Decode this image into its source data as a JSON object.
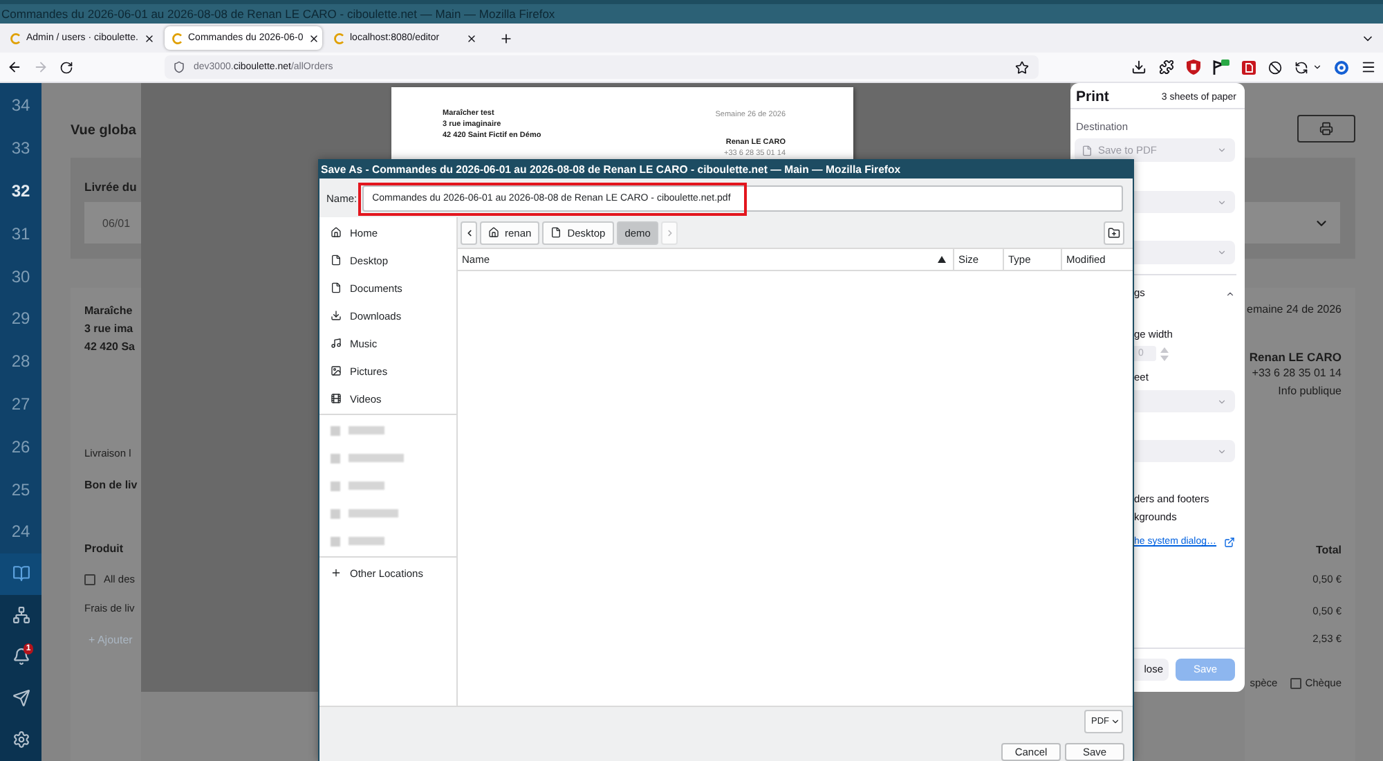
{
  "window": {
    "title": "Commandes du 2026-06-01 au 2026-08-08 de Renan LE CARO - ciboulette.net — Main — Mozilla Firefox"
  },
  "tabs": [
    {
      "label": "Admin / users · ciboulette.",
      "selected": false
    },
    {
      "label": "Commandes du 2026-06-0",
      "selected": true
    },
    {
      "label": "localhost:8080/editor",
      "selected": false
    }
  ],
  "navigation": {
    "back_disabled": false,
    "forward_disabled": true
  },
  "address_bar": {
    "host_prefix": "dev3000.",
    "domain": "ciboulette.net",
    "path": "/allOrders"
  },
  "sidebar": {
    "weeks": [
      {
        "label": "34",
        "selected": false
      },
      {
        "label": "33",
        "selected": false
      },
      {
        "label": "32",
        "selected": true
      },
      {
        "label": "31",
        "selected": false
      },
      {
        "label": "30",
        "selected": false
      },
      {
        "label": "29",
        "selected": false
      },
      {
        "label": "28",
        "selected": false
      },
      {
        "label": "27",
        "selected": false
      },
      {
        "label": "26",
        "selected": false
      },
      {
        "label": "25",
        "selected": false
      },
      {
        "label": "24",
        "selected": false
      }
    ],
    "sections": [
      {
        "selected": true
      },
      {
        "selected": false
      },
      {
        "selected": false
      },
      {
        "selected": false
      },
      {
        "selected": false
      }
    ],
    "notification_count": "1"
  },
  "page": {
    "left": {
      "heading": "Vue globa",
      "filter_label": "Livrée du",
      "date_value": "06/01",
      "producer_lines": [
        "Maraîche",
        "3 rue ima",
        "42 420 Sa"
      ],
      "delivery_label": "Livraison l",
      "delivery_note": "Bon de liv",
      "product_header": "Produit",
      "product_row": {
        "label": "All des",
        "checked": false
      },
      "fee_label": "Frais de liv",
      "add_link": "+ Ajouter"
    },
    "right": {
      "week": "emaine 24 de 2026",
      "seller_lines": [
        "Renan LE CARO",
        "+33 6 28 35 01 14",
        "Info publique"
      ],
      "total_header": "Total",
      "amounts": [
        "0,50 €",
        "0,50 €",
        "2,53 €"
      ],
      "payment_cut": "spèce",
      "cheque": {
        "label": "Chèque",
        "checked": false
      }
    }
  },
  "print_preview": {
    "left_lines": [
      "Maraîcher test",
      "3 rue imaginaire",
      "42 420 Saint Fictif en Démo"
    ],
    "week": "Semaine 26 de 2026",
    "seller_name": "Renan LE CARO",
    "seller_phone": "+33 6 28 35 01 14"
  },
  "print_panel": {
    "title": "Print",
    "sheet_count": "3 sheets of paper",
    "destination_label": "Destination",
    "destination": "Save to PDF",
    "more_settings": {
      "label": "gs",
      "expanded": true
    },
    "fit_label": "ge width",
    "scale_field": {
      "value": "0",
      "disabled": true
    },
    "pages_label": "eet",
    "headers_label": "ders and footers",
    "backgrounds_label": "kgrounds",
    "system_dialog_link": "he system dialog…",
    "close_button": "lose",
    "save_button": {
      "label": "Save",
      "disabled": true
    }
  },
  "save_dialog": {
    "title": "Save As - Commandes du 2026-06-01 au 2026-08-08 de Renan LE CARO - ciboulette.net — Main — Mozilla Firefox",
    "name_label": "Name:",
    "file_name": {
      "value": "Commandes du 2026-06-01 au 2026-08-08 de Renan LE CARO - ciboulette.net.pdf",
      "highlighted": true
    },
    "places": [
      {
        "kind": "place",
        "label": "Home"
      },
      {
        "kind": "place",
        "label": "Desktop"
      },
      {
        "kind": "place",
        "label": "Documents"
      },
      {
        "kind": "place",
        "label": "Downloads"
      },
      {
        "kind": "place",
        "label": "Music"
      },
      {
        "kind": "place",
        "label": "Pictures"
      },
      {
        "kind": "place",
        "label": "Videos"
      },
      {
        "kind": "blurred"
      },
      {
        "kind": "blurred"
      },
      {
        "kind": "blurred"
      },
      {
        "kind": "blurred"
      },
      {
        "kind": "blurred"
      },
      {
        "kind": "action",
        "label": "Other Locations"
      }
    ],
    "path_scroll": {
      "back_disabled": false,
      "forward_disabled": true
    },
    "path": [
      {
        "label": "renan",
        "selected": false
      },
      {
        "label": "Desktop",
        "selected": false
      },
      {
        "label": "demo",
        "selected": true
      }
    ],
    "columns": [
      {
        "label": "Name",
        "sorted": true
      },
      {
        "label": "Size",
        "sorted": false
      },
      {
        "label": "Type",
        "sorted": false
      },
      {
        "label": "Modified",
        "sorted": false
      }
    ],
    "file_type": "PDF",
    "buttons": [
      "Cancel",
      "Save"
    ]
  }
}
